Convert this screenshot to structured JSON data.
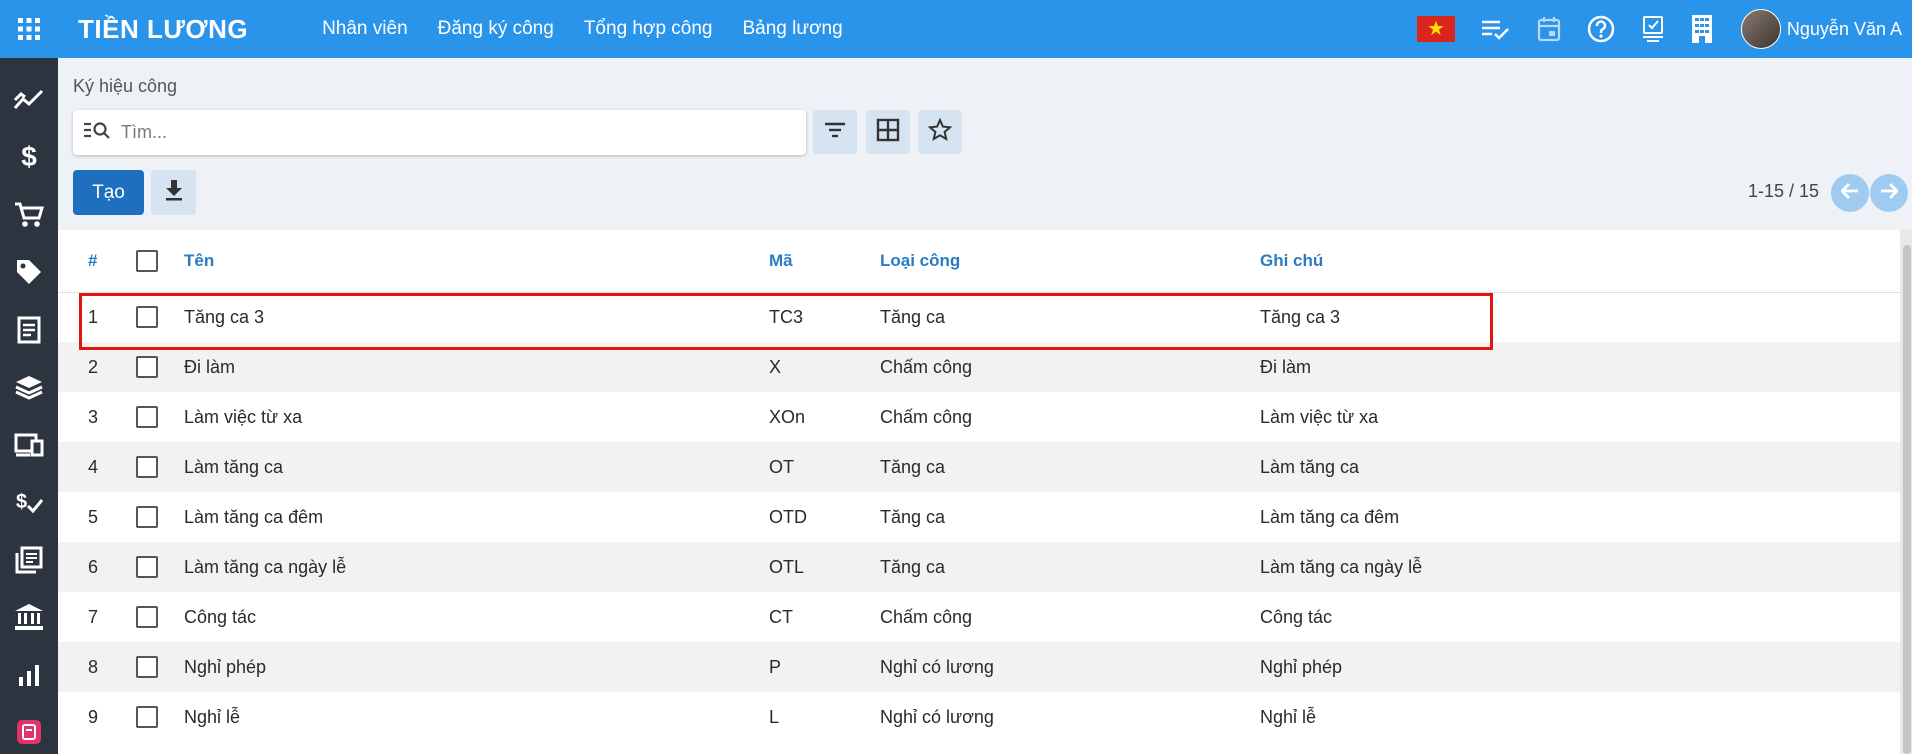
{
  "app": {
    "title": "TIỀN LƯƠNG"
  },
  "menu": [
    {
      "label": "Nhân viên"
    },
    {
      "label": "Đăng ký công"
    },
    {
      "label": "Tổng hợp công"
    },
    {
      "label": "Bảng lương"
    }
  ],
  "topbar": {
    "flag": "vietnam-flag-icon",
    "icons": [
      "checklist-icon",
      "calendar-icon",
      "help-icon",
      "approval-icon",
      "building-icon"
    ],
    "user_name": "Nguyễn Văn A"
  },
  "sidebar": {
    "icons": [
      "analytics-icon",
      "dollar-icon",
      "cart-icon",
      "tag-icon",
      "document-icon",
      "stack-icon",
      "devices-icon",
      "payment-check-icon",
      "library-icon",
      "bank-icon",
      "bar-chart-icon",
      "app-icon"
    ]
  },
  "page": {
    "breadcrumb": "Ký hiệu công",
    "search_placeholder": "Tìm...",
    "create_label": "Tạo",
    "pager": "1-15 / 15"
  },
  "table": {
    "headers": {
      "num": "#",
      "name": "Tên",
      "code": "Mã",
      "type": "Loại công",
      "note": "Ghi chú"
    },
    "rows": [
      {
        "num": "1",
        "name": "Tăng ca 3",
        "code": "TC3",
        "type": "Tăng ca",
        "note": "Tăng ca 3"
      },
      {
        "num": "2",
        "name": "Đi làm",
        "code": "X",
        "type": "Chấm công",
        "note": "Đi làm"
      },
      {
        "num": "3",
        "name": "Làm việc từ xa",
        "code": "XOn",
        "type": "Chấm công",
        "note": "Làm việc từ xa"
      },
      {
        "num": "4",
        "name": "Làm tăng ca",
        "code": "OT",
        "type": "Tăng ca",
        "note": "Làm tăng ca"
      },
      {
        "num": "5",
        "name": "Làm tăng ca đêm",
        "code": "OTD",
        "type": "Tăng ca",
        "note": "Làm tăng ca đêm"
      },
      {
        "num": "6",
        "name": "Làm tăng ca ngày lễ",
        "code": "OTL",
        "type": "Tăng ca",
        "note": "Làm tăng ca ngày lễ"
      },
      {
        "num": "7",
        "name": "Công tác",
        "code": "CT",
        "type": "Chấm công",
        "note": "Công tác"
      },
      {
        "num": "8",
        "name": "Nghỉ phép",
        "code": "P",
        "type": "Nghỉ có lương",
        "note": "Nghỉ phép"
      },
      {
        "num": "9",
        "name": "Nghỉ lễ",
        "code": "L",
        "type": "Nghỉ có lương",
        "note": "Nghỉ lễ"
      }
    ]
  },
  "colors": {
    "topbar": "#2a93ea",
    "sidebar": "#2c3440",
    "accent": "#1f6fbf",
    "highlight": "#e31414"
  }
}
